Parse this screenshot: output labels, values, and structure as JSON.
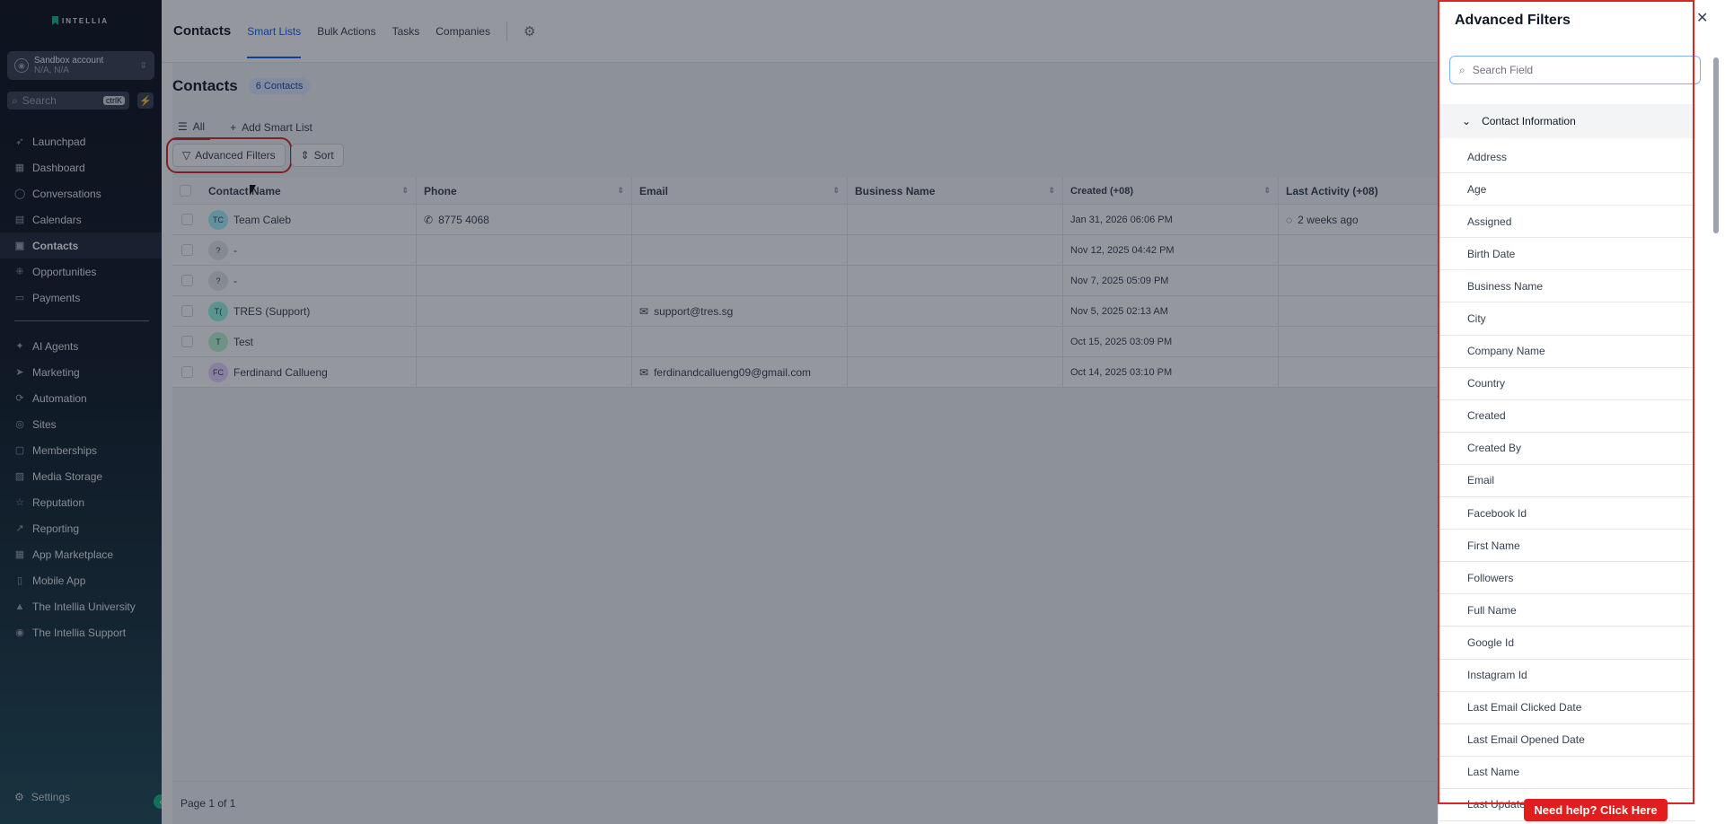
{
  "brand": "INTELLIA",
  "account": {
    "name": "Sandbox account",
    "location": "N/A, N/A"
  },
  "sidebar_search": {
    "placeholder": "Search",
    "shortcut": "ctrlK"
  },
  "nav_primary": [
    {
      "label": "Launchpad",
      "icon": "rocket-icon"
    },
    {
      "label": "Dashboard",
      "icon": "grid-icon"
    },
    {
      "label": "Conversations",
      "icon": "chat-icon"
    },
    {
      "label": "Calendars",
      "icon": "calendar-icon"
    },
    {
      "label": "Contacts",
      "icon": "contacts-icon",
      "active": true
    },
    {
      "label": "Opportunities",
      "icon": "opportunities-icon"
    },
    {
      "label": "Payments",
      "icon": "payments-icon"
    }
  ],
  "nav_secondary": [
    {
      "label": "AI Agents",
      "icon": "sparkle-icon"
    },
    {
      "label": "Marketing",
      "icon": "send-icon"
    },
    {
      "label": "Automation",
      "icon": "automation-icon"
    },
    {
      "label": "Sites",
      "icon": "globe-icon"
    },
    {
      "label": "Memberships",
      "icon": "memberships-icon"
    },
    {
      "label": "Media Storage",
      "icon": "image-icon"
    },
    {
      "label": "Reputation",
      "icon": "star-icon"
    },
    {
      "label": "Reporting",
      "icon": "trend-icon"
    },
    {
      "label": "App Marketplace",
      "icon": "apps-icon"
    },
    {
      "label": "Mobile App",
      "icon": "phone-icon"
    },
    {
      "label": "The Intellia University",
      "icon": "cap-icon"
    },
    {
      "label": "The Intellia Support",
      "icon": "support-icon"
    }
  ],
  "settings_label": "Settings",
  "topbar": {
    "title": "Contacts",
    "tabs": [
      "Smart Lists",
      "Bulk Actions",
      "Tasks",
      "Companies"
    ]
  },
  "page": {
    "heading": "Contacts",
    "count_badge": "6 Contacts",
    "views": {
      "all": "All",
      "add": "Add Smart List"
    },
    "toolbar": {
      "filters": "Advanced Filters",
      "sort": "Sort"
    }
  },
  "table": {
    "columns": [
      "Contact Name",
      "Phone",
      "Email",
      "Business Name",
      "Created (+08)",
      "Last Activity (+08)"
    ],
    "rows": [
      {
        "initials": "TC",
        "name": "Team Caleb",
        "phone": "8775 4068",
        "email": "",
        "business": "",
        "created": "Jan 31, 2026 06:06 PM",
        "activity": "2 weeks ago",
        "color": "#a5f3fc"
      },
      {
        "initials": "?",
        "name": "-",
        "phone": "",
        "email": "",
        "business": "",
        "created": "Nov 12, 2025 04:42 PM",
        "activity": "",
        "color": "#e5e7eb"
      },
      {
        "initials": "?",
        "name": "-",
        "phone": "",
        "email": "",
        "business": "",
        "created": "Nov 7, 2025 05:09 PM",
        "activity": "",
        "color": "#e5e7eb"
      },
      {
        "initials": "T(",
        "name": "TRES (Support)",
        "phone": "",
        "email": "support@tres.sg",
        "business": "",
        "created": "Nov 5, 2025 02:13 AM",
        "activity": "",
        "color": "#99f6e4"
      },
      {
        "initials": "T",
        "name": "Test",
        "phone": "",
        "email": "",
        "business": "",
        "created": "Oct 15, 2025 03:09 PM",
        "activity": "",
        "color": "#bbf7d0"
      },
      {
        "initials": "FC",
        "name": "Ferdinand Callueng",
        "phone": "",
        "email": "ferdinandcallueng09@gmail.com",
        "business": "",
        "created": "Oct 14, 2025 03:10 PM",
        "activity": "",
        "color": "#e9d5ff"
      }
    ]
  },
  "pagination": "Page 1 of 1",
  "drawer": {
    "title": "Advanced Filters",
    "search_placeholder": "Search Field",
    "section": "Contact Information",
    "fields": [
      "Address",
      "Age",
      "Assigned",
      "Birth Date",
      "Business Name",
      "City",
      "Company Name",
      "Country",
      "Created",
      "Created By",
      "Email",
      "Facebook Id",
      "First Name",
      "Followers",
      "Full Name",
      "Google Id",
      "Instagram Id",
      "Last Email Clicked Date",
      "Last Email Opened Date",
      "Last Name",
      "Last Update"
    ]
  },
  "help_button": "Need help? Click Here"
}
